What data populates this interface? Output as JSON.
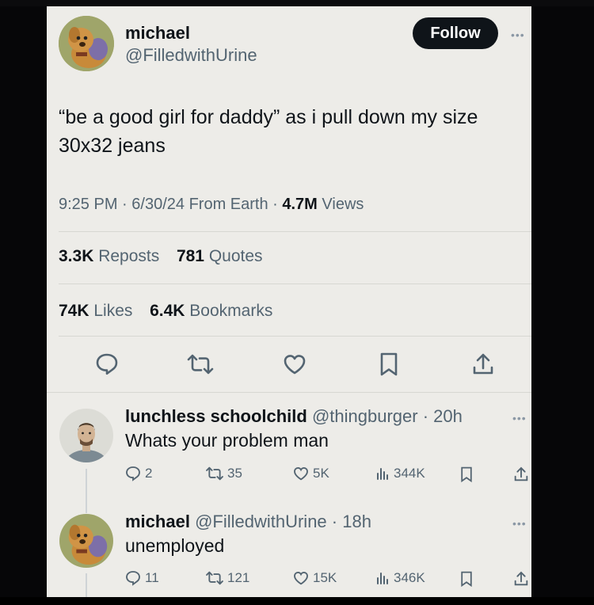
{
  "main_tweet": {
    "display_name": "michael",
    "handle": "@FilledwithUrine",
    "follow_label": "Follow",
    "text": "“be a good girl for daddy” as i pull down my size 30x32 jeans",
    "time": "9:25 PM",
    "date": "6/30/24",
    "location": "From Earth",
    "views_count": "4.7M",
    "views_label": "Views",
    "reposts_count": "3.3K",
    "reposts_label": "Reposts",
    "quotes_count": "781",
    "quotes_label": "Quotes",
    "likes_count": "74K",
    "likes_label": "Likes",
    "bookmarks_count": "6.4K",
    "bookmarks_label": "Bookmarks",
    "actions": [
      "reply-icon",
      "repost-icon",
      "like-icon",
      "bookmark-icon",
      "share-icon"
    ]
  },
  "replies": [
    {
      "display_name": "lunchless schoolchild",
      "handle": "@thingburger",
      "time": "20h",
      "text": "Whats your problem man",
      "reply_count": "2",
      "repost_count": "35",
      "like_count": "5K",
      "view_count": "344K"
    },
    {
      "display_name": "michael",
      "handle": "@FilledwithUrine",
      "time": "18h",
      "text": "unemployed",
      "reply_count": "11",
      "repost_count": "121",
      "like_count": "15K",
      "view_count": "346K"
    }
  ],
  "colors": {
    "background": "#edece8",
    "text": "#0f1419",
    "muted": "#536471",
    "follow_button": "#0f1419"
  }
}
